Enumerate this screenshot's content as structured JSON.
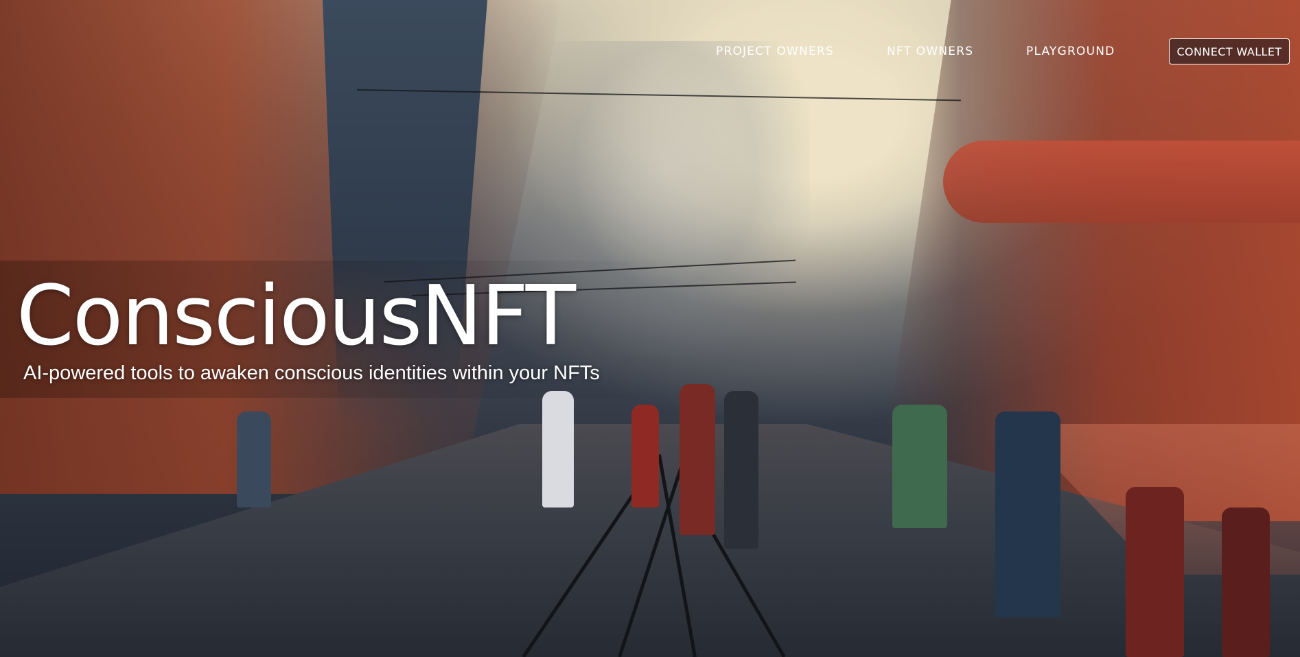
{
  "page": {
    "title": "ConsciousNFT",
    "subtitle": "AI-powered tools to awaken conscious identities within your NFTs"
  },
  "nav": {
    "links": [
      {
        "label": "PROJECT OWNERS"
      },
      {
        "label": "NFT OWNERS"
      },
      {
        "label": "PLAYGROUND"
      }
    ],
    "connect_wallet_label": "CONNECT WALLET"
  },
  "background": {
    "description_icon": "cyberpunk-city-street-image",
    "colors": {
      "accent_warm": "#c2503a",
      "sky": "#eee3c6",
      "street_dark": "#262b33"
    }
  }
}
